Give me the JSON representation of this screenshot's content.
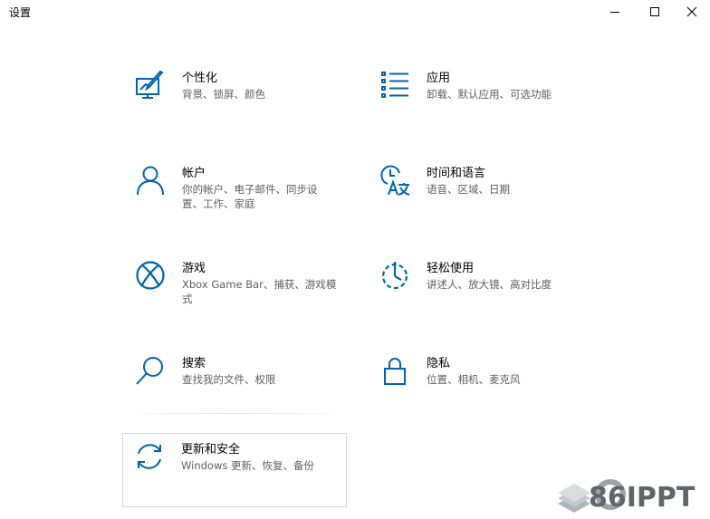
{
  "window": {
    "title": "设置"
  },
  "colors": {
    "accent": "#0063b1",
    "secondary_text": "#5f5f5f",
    "border": "#d9d9d9"
  },
  "tiles": [
    {
      "icon": "personalization-icon",
      "name": "个性化",
      "desc": "背景、锁屏、颜色"
    },
    {
      "icon": "apps-icon",
      "name": "应用",
      "desc": "卸载、默认应用、可选功能"
    },
    {
      "icon": "account-icon",
      "name": "帐户",
      "desc": "你的帐户、电子邮件、同步设置、工作、家庭"
    },
    {
      "icon": "time-language-icon",
      "name": "时间和语言",
      "desc": "语音、区域、日期"
    },
    {
      "icon": "xbox-icon",
      "name": "游戏",
      "desc": "Xbox Game Bar、捕获、游戏模式"
    },
    {
      "icon": "ease-of-access-icon",
      "name": "轻松使用",
      "desc": "讲述人、放大镜、高对比度"
    },
    {
      "icon": "search-icon",
      "name": "搜索",
      "desc": "查找我的文件、权限"
    },
    {
      "icon": "lock-icon",
      "name": "隐私",
      "desc": "位置、相机、麦克风"
    },
    {
      "icon": "update-icon",
      "name": "更新和安全",
      "desc": "Windows 更新、恢复、备份"
    }
  ],
  "watermark": {
    "text": "86IPPT"
  }
}
